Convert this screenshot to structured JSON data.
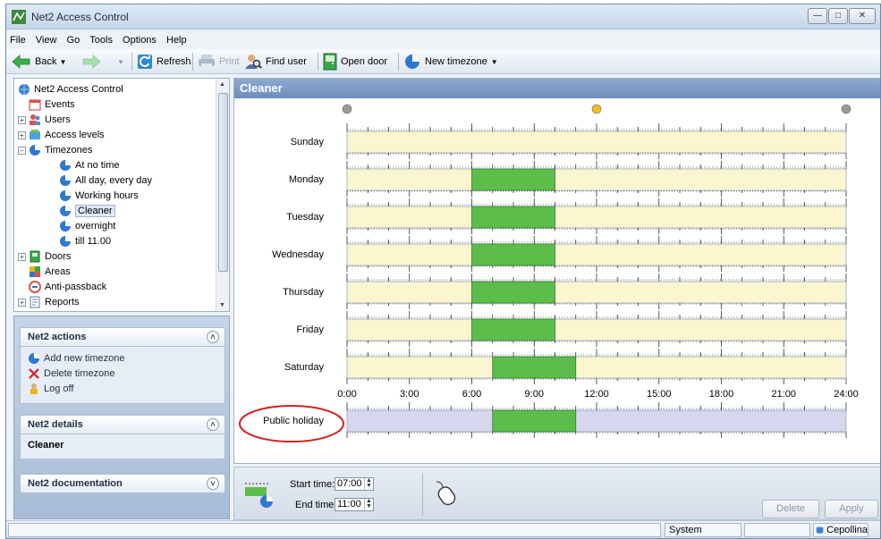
{
  "window": {
    "title": "Net2 Access Control"
  },
  "menu": [
    "File",
    "View",
    "Go",
    "Tools",
    "Options",
    "Help"
  ],
  "toolbar": {
    "back": "Back",
    "refresh": "Refresh",
    "print": "Print",
    "find_user": "Find user",
    "open_door": "Open door",
    "new_timezone": "New timezone"
  },
  "tree": {
    "root": "Net2 Access Control",
    "items": [
      "Events",
      "Users",
      "Access levels",
      "Timezones",
      "Doors",
      "Areas",
      "Anti-passback",
      "Reports"
    ],
    "timezones": [
      "At no time",
      "All day, every day",
      "Working hours",
      "Cleaner",
      "overnight",
      "till 11.00"
    ]
  },
  "panels": {
    "actions_title": "Net2 actions",
    "actions": [
      "Add new timezone",
      "Delete timezone",
      "Log off"
    ],
    "details_title": "Net2 details",
    "details_value": "Cleaner",
    "docs_title": "Net2 documentation"
  },
  "content": {
    "title": "Cleaner",
    "days": [
      "Sunday",
      "Monday",
      "Tuesday",
      "Wednesday",
      "Thursday",
      "Friday",
      "Saturday"
    ],
    "holiday_label": "Public holiday",
    "time_labels": [
      "0:00",
      "3:00",
      "6:00",
      "9:00",
      "12:00",
      "15:00",
      "18:00",
      "21:00",
      "24:00"
    ],
    "rows": [
      {
        "start": null,
        "end": null
      },
      {
        "start": 6,
        "end": 10
      },
      {
        "start": 6,
        "end": 10
      },
      {
        "start": 6,
        "end": 10
      },
      {
        "start": 6,
        "end": 10
      },
      {
        "start": 6,
        "end": 10
      },
      {
        "start": 7,
        "end": 11
      }
    ],
    "holiday": {
      "start": 7,
      "end": 11
    },
    "colors": {
      "inactive": "#fbf6cf",
      "active": "#5cbd4a",
      "holiday_inactive": "#d8d5ee"
    }
  },
  "editor": {
    "start_label": "Start time:",
    "start_value": "07:00",
    "end_label": "End time:",
    "end_value": "11:00",
    "delete": "Delete",
    "apply": "Apply"
  },
  "status": {
    "role": "System engineer",
    "site": "Cepollina"
  }
}
